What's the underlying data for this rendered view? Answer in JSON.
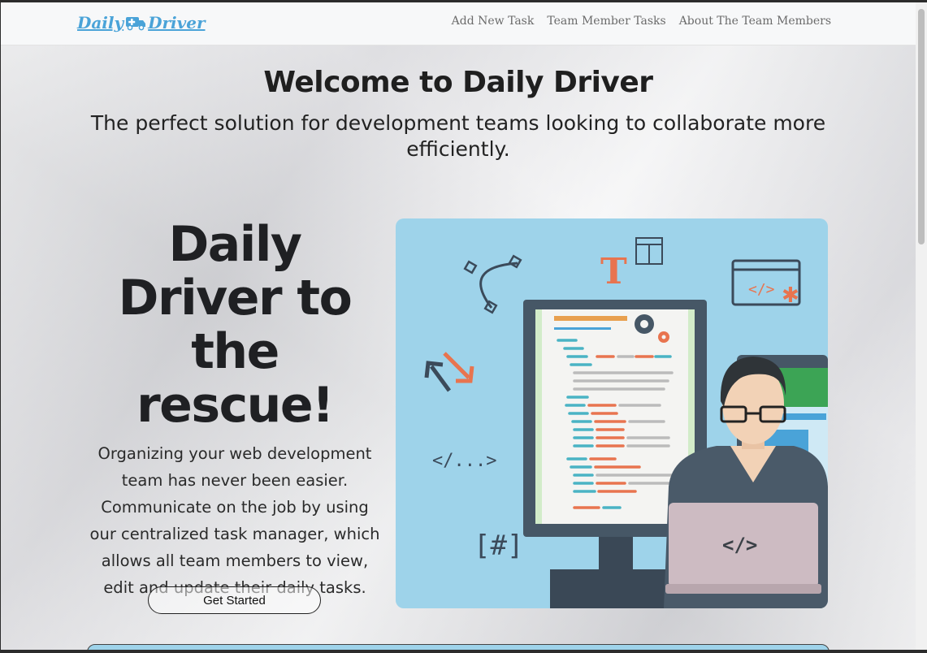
{
  "brand": {
    "name_part1": "Daily",
    "name_part2": "Driver"
  },
  "nav": {
    "links": [
      "Add New Task",
      "Team Member Tasks",
      "About The Team Members"
    ]
  },
  "hero": {
    "title": "Welcome to Daily Driver",
    "subtitle": "The perfect solution for development teams looking to collaborate more efficiently."
  },
  "intro": {
    "heading": "Daily Driver to the rescue!",
    "description": "Organizing your web development team has never been easier. Communicate on the job by using our centralized task manager, which allows all team members to view, edit and update their daily tasks.",
    "cta_label": "Get Started"
  },
  "illustration": {
    "code_tag": "</>",
    "ellipsis_tag": "</...>",
    "hash_tag": "[#]",
    "letter_t": "T",
    "laptop_tag": "</>"
  },
  "colors": {
    "brand_blue": "#4aa3d8",
    "illustration_bg": "#9ed3ea",
    "accent_orange": "#e8744f"
  }
}
